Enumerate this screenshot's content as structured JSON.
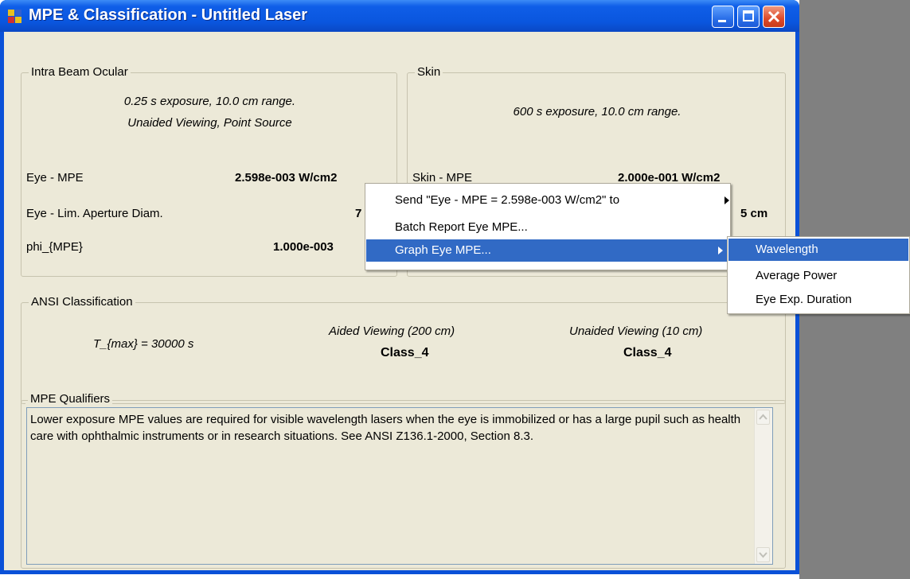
{
  "window": {
    "title": "MPE & Classification - Untitled Laser"
  },
  "intra_beam": {
    "label": "Intra Beam Ocular",
    "line1": "0.25 s exposure, 10.0 cm range.",
    "line2": "Unaided Viewing, Point Source",
    "rows": [
      {
        "label": "Eye - MPE",
        "value": "2.598e-003 W/cm2"
      },
      {
        "label": "Eye - Lim. Aperture Diam.",
        "value": "7 m"
      },
      {
        "label": "phi_{MPE}",
        "value": "1.000e-003"
      }
    ]
  },
  "skin": {
    "label": "Skin",
    "line1": "600 s exposure, 10.0 cm range.",
    "rows": [
      {
        "label": "Skin - MPE",
        "value": "2.000e-001 W/cm2"
      },
      {
        "label": "",
        "value": "5 cm"
      }
    ]
  },
  "ansi": {
    "label": "ANSI Classification",
    "tmax": "T_{max} = 30000 s",
    "aided_label": "Aided Viewing (200 cm)",
    "aided_class": "Class_4",
    "unaided_label": "Unaided Viewing (10 cm)",
    "unaided_class": "Class_4"
  },
  "qualifiers": {
    "label": "MPE Qualifiers",
    "text": "Lower exposure MPE values are required for visible wavelength lasers when the eye is immobilized or has a large pupil such as health care with ophthalmic instruments or in research situations.  See ANSI Z136.1-2000, Section 8.3."
  },
  "context_menu": {
    "items": [
      {
        "label": "Send \"Eye - MPE = 2.598e-003 W/cm2\" to",
        "submenu": true
      },
      {
        "label": "Batch Report Eye MPE...",
        "submenu": false
      },
      {
        "label": "Graph Eye MPE...",
        "submenu": true,
        "highlighted": true
      }
    ]
  },
  "submenu": {
    "items": [
      {
        "label": "Wavelength",
        "highlighted": true
      },
      {
        "label": "Average Power"
      },
      {
        "label": "Eye Exp. Duration"
      }
    ]
  },
  "colors": {
    "titlebar": "#0a56de",
    "dialog_bg": "#ece9d8",
    "menu_highlight": "#316ac5",
    "close_button": "#de4a2a"
  }
}
